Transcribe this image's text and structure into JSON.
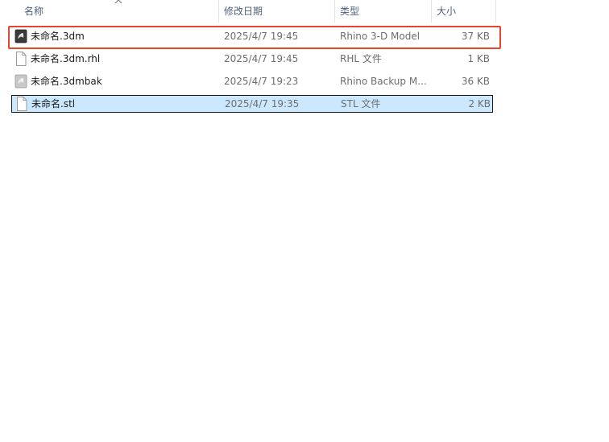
{
  "columns": {
    "name": "名称",
    "date": "修改日期",
    "type": "类型",
    "size": "大小"
  },
  "files": [
    {
      "name": "未命名.3dm",
      "date": "2025/4/7 19:45",
      "type": "Rhino 3-D Model",
      "size": "37 KB",
      "icon": "rhino-3dm-file-icon",
      "highlighted": true
    },
    {
      "name": "未命名.3dm.rhl",
      "date": "2025/4/7 19:45",
      "type": "RHL 文件",
      "size": "1 KB",
      "icon": "blank-file-icon"
    },
    {
      "name": "未命名.3dmbak",
      "date": "2025/4/7 19:23",
      "type": "Rhino Backup M...",
      "size": "36 KB",
      "icon": "rhino-backup-file-icon"
    },
    {
      "name": "未命名.stl",
      "date": "2025/4/7 19:35",
      "type": "STL 文件",
      "size": "2 KB",
      "icon": "blank-file-icon",
      "selected": true
    }
  ],
  "colors": {
    "selection": "#cce8ff",
    "highlight_box": "#e5452b",
    "header_text": "#4c607a"
  }
}
